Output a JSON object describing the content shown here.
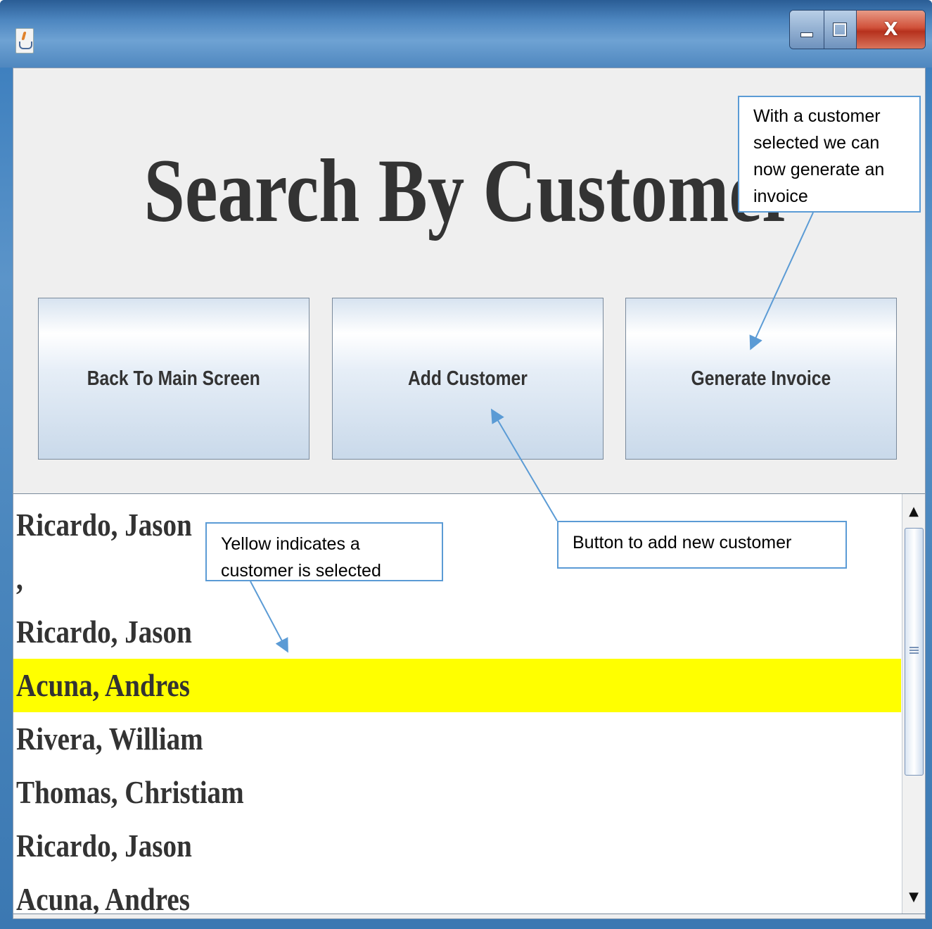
{
  "window": {
    "app_icon": "java-cup-icon",
    "controls": {
      "close_label": "X"
    }
  },
  "heading": "Search By Customer",
  "buttons": {
    "back": "Back To Main Screen",
    "add": "Add Customer",
    "invoice": "Generate Invoice"
  },
  "customer_list": {
    "items": [
      {
        "label": "Ricardo, Jason"
      },
      {
        "label": ","
      },
      {
        "label": "Ricardo, Jason"
      },
      {
        "label": "Acuna, Andres",
        "selected": true
      },
      {
        "label": "Rivera, William"
      },
      {
        "label": "Thomas, Christiam"
      },
      {
        "label": "Ricardo, Jason"
      },
      {
        "label": " Acuna, Andres"
      }
    ],
    "selected_color": "#ffff00"
  },
  "callouts": {
    "invoice": "With a customer selected we can now generate an invoice",
    "yellow": "Yellow indicates a customer is selected",
    "add": "Button to add new customer"
  },
  "colors": {
    "callout_border": "#5b9bd5",
    "selection": "#ffff00"
  }
}
